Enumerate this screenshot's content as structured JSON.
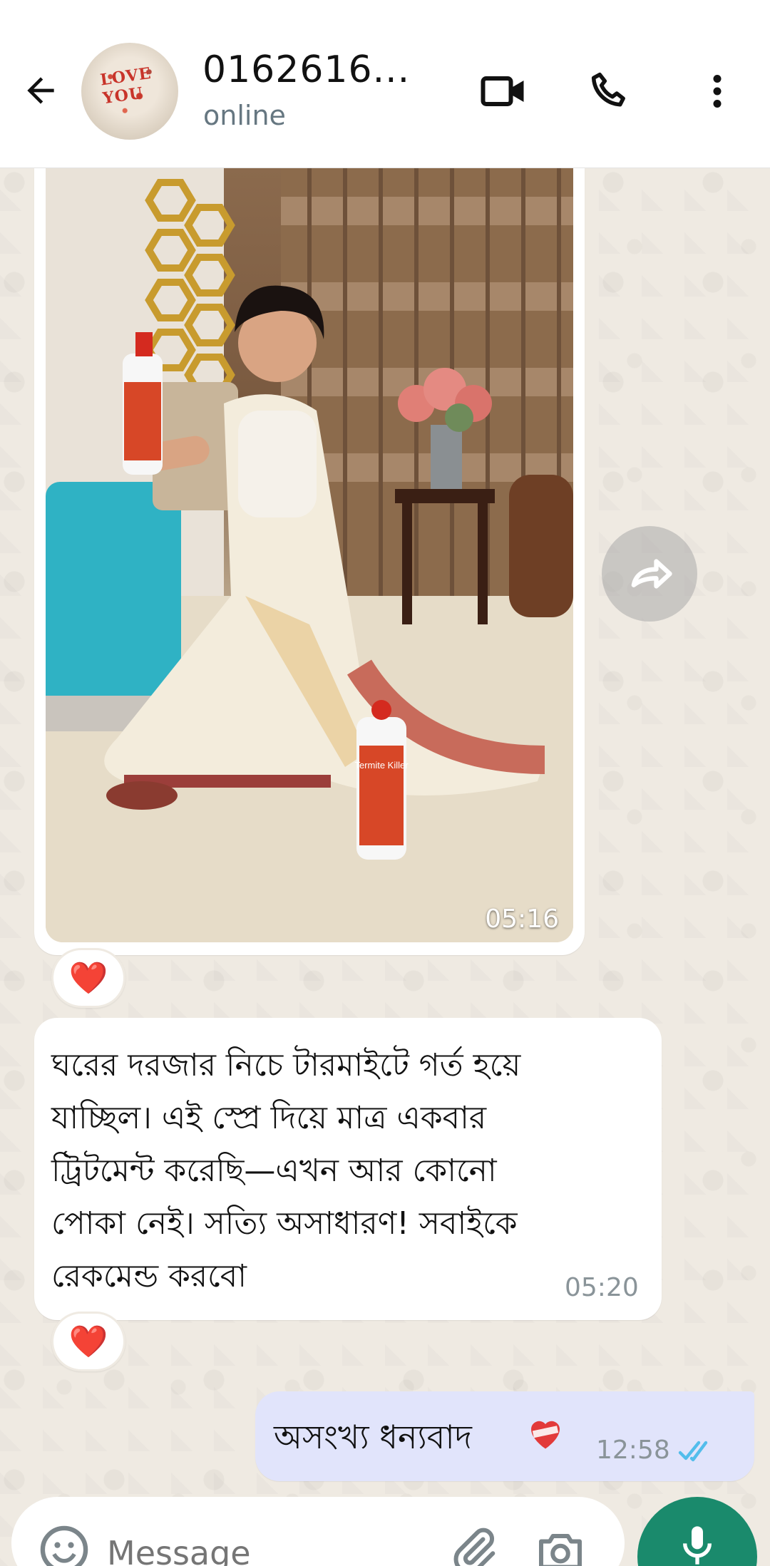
{
  "header": {
    "back_label": "Back",
    "contact_name": "0162616...",
    "status": "online",
    "avatar_caption": "LOVE YOU"
  },
  "messages": [
    {
      "type": "image",
      "direction": "incoming",
      "time": "05:16",
      "reaction": "❤️"
    },
    {
      "type": "text",
      "direction": "incoming",
      "lines": [
        "ঘরের দরজার নিচে টারমাইটে গর্ত হয়ে",
        "যাচ্ছিল। এই স্প্রে দিয়ে মাত্র একবার",
        "ট্রিটমেন্ট করেছি—এখন আর কোনো",
        "পোকা নেই। সত্যি অসাধারণ! সবাইকে",
        "রেকমেন্ড করবো"
      ],
      "time": "05:20",
      "reaction": "❤️"
    },
    {
      "type": "text",
      "direction": "outgoing",
      "text": "অসংখ্য ধন্যবাদ",
      "time": "12:58",
      "status": "read"
    }
  ],
  "photo_labels": {
    "bottle_brand": "Termite Killer"
  },
  "composer": {
    "placeholder": "Message"
  },
  "colors": {
    "accent": "#1a8a6c",
    "read_tick": "#53bdeb",
    "outgoing_bubble": "#e1e4fb",
    "chat_background": "#efeae2"
  },
  "icons": {
    "back": "arrow-left-icon",
    "video": "video-camera-icon",
    "call": "phone-icon",
    "menu": "more-vertical-icon",
    "forward": "forward-icon",
    "emoji": "smiley-icon",
    "attach": "paperclip-icon",
    "camera": "camera-icon",
    "mic": "microphone-icon"
  }
}
